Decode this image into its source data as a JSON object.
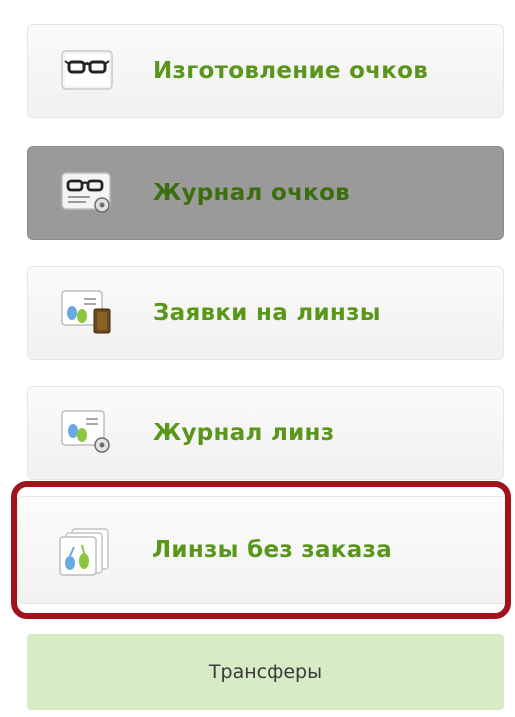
{
  "menu": {
    "items": [
      {
        "label": "Изготовление очков",
        "icon": "glasses-icon"
      },
      {
        "label": "Журнал очков",
        "icon": "glasses-journal-icon",
        "active": true
      },
      {
        "label": "Заявки на линзы",
        "icon": "lens-order-icon"
      },
      {
        "label": "Журнал линз",
        "icon": "lens-journal-icon"
      },
      {
        "label": "Линзы без заказа",
        "icon": "lens-stack-icon",
        "highlighted": true
      }
    ],
    "transfer_label": "Трансферы"
  },
  "colors": {
    "label_green": "#5a961a",
    "active_background": "#9a9a9a",
    "highlight_border": "#a0131c",
    "transfer_background": "#d6ebc6"
  }
}
